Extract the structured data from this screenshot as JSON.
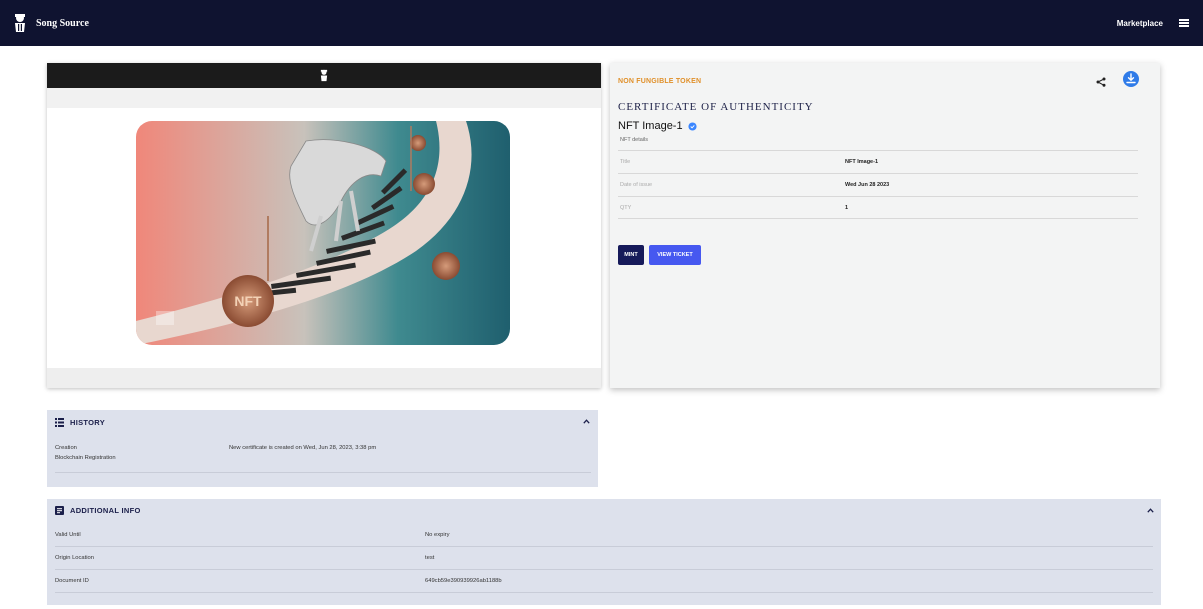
{
  "topbar": {
    "brand_name": "Song Source",
    "nav_link": "Marketplace"
  },
  "certificate": {
    "overline": "NON FUNGIBLE TOKEN",
    "title": "CERTIFICATE OF AUTHENTICITY",
    "nft_name": "NFT Image-1",
    "details_label": "NFT details",
    "rows": [
      {
        "key": "Title",
        "value": "NFT Image-1"
      },
      {
        "key": "Date of issue",
        "value": "Wed Jun 28 2023"
      },
      {
        "key": "QTY",
        "value": "1"
      }
    ],
    "mint_label": "MINT",
    "view_ticket_label": "VIEW TICKET"
  },
  "history": {
    "title": "HISTORY",
    "rows": [
      {
        "key": "Creation",
        "value": "New certificate is created on Wed, Jun 28, 2023, 3:38 pm"
      },
      {
        "key": "Blockchain Registration",
        "value": ""
      }
    ]
  },
  "additional_info": {
    "title": "ADDITIONAL INFO",
    "rows": [
      {
        "key": "Valid Until",
        "value": "No expiry"
      },
      {
        "key": "Origin Location",
        "value": "test"
      },
      {
        "key": "Document ID",
        "value": "649cb59e390939926ab1188b"
      }
    ]
  },
  "artwork": {
    "coin_text": "NFT"
  },
  "colors": {
    "topbar": "#0f1330",
    "accent_orange": "#e0902a",
    "mint_button": "#161a5a",
    "view_button": "#4658f0",
    "panel_bg": "#dde1ec"
  }
}
